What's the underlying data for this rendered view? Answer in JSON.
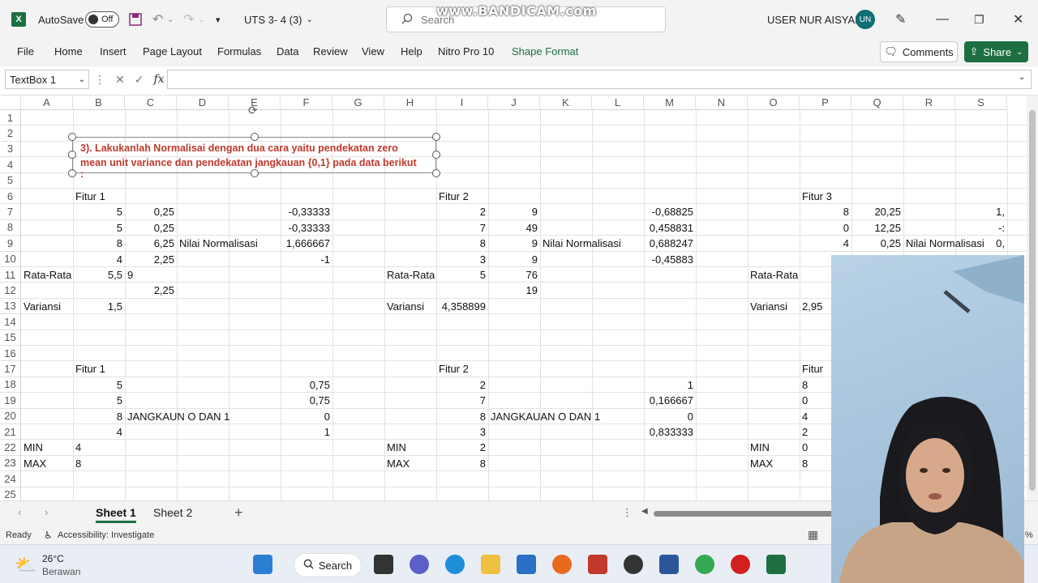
{
  "titlebar": {
    "autosave_label": "AutoSave",
    "autosave_state": "Off",
    "file_name": "UTS 3- 4 (3)",
    "search_placeholder": "Search",
    "watermark": "www.BANDICAM.com",
    "user_name": "USER NUR AISYAH",
    "user_initials": "UN"
  },
  "ribbon": {
    "tabs": [
      "File",
      "Home",
      "Insert",
      "Page Layout",
      "Formulas",
      "Data",
      "Review",
      "View",
      "Help",
      "Nitro Pro 10",
      "Shape Format"
    ],
    "active_tab": "Shape Format",
    "comments_label": "Comments",
    "share_label": "Share"
  },
  "formula_bar": {
    "name_box": "TextBox 1",
    "fx_label": "fx",
    "formula": ""
  },
  "columns": [
    "A",
    "B",
    "C",
    "D",
    "E",
    "F",
    "G",
    "H",
    "I",
    "J",
    "K",
    "L",
    "M",
    "N",
    "O",
    "P",
    "Q",
    "R",
    "S"
  ],
  "rows": [
    "1",
    "2",
    "3",
    "4",
    "5",
    "6",
    "7",
    "8",
    "9",
    "10",
    "11",
    "12",
    "13",
    "14",
    "15",
    "16",
    "17",
    "18",
    "19",
    "20",
    "21",
    "22",
    "23",
    "24",
    "25"
  ],
  "textbox": {
    "line1": "3). Lakukanlah Normalisai dengan dua cara yaitu pendekatan zero",
    "line2": "mean unit variance dan pendekatan jangkauan {0,1} pada data berikut",
    "line3": ":"
  },
  "cells": [
    {
      "ref": "B6",
      "text": "Fitur 1",
      "align": "l"
    },
    {
      "ref": "I6",
      "text": "Fitur 2",
      "align": "l"
    },
    {
      "ref": "P6",
      "text": "Fitur 3",
      "align": "l"
    },
    {
      "ref": "B7",
      "text": "5",
      "align": "r"
    },
    {
      "ref": "C7",
      "text": "0,25",
      "align": "r"
    },
    {
      "ref": "F7",
      "text": "-0,33333",
      "align": "r"
    },
    {
      "ref": "I7",
      "text": "2",
      "align": "r"
    },
    {
      "ref": "J7",
      "text": "9",
      "align": "r"
    },
    {
      "ref": "M7",
      "text": "-0,68825",
      "align": "r"
    },
    {
      "ref": "P7",
      "text": "8",
      "align": "r"
    },
    {
      "ref": "Q7",
      "text": "20,25",
      "align": "r"
    },
    {
      "ref": "S7",
      "text": "1,",
      "align": "r"
    },
    {
      "ref": "B8",
      "text": "5",
      "align": "r"
    },
    {
      "ref": "C8",
      "text": "0,25",
      "align": "r"
    },
    {
      "ref": "F8",
      "text": "-0,33333",
      "align": "r"
    },
    {
      "ref": "I8",
      "text": "7",
      "align": "r"
    },
    {
      "ref": "J8",
      "text": "49",
      "align": "r"
    },
    {
      "ref": "M8",
      "text": "0,458831",
      "align": "r"
    },
    {
      "ref": "P8",
      "text": "0",
      "align": "r"
    },
    {
      "ref": "Q8",
      "text": "12,25",
      "align": "r"
    },
    {
      "ref": "S8",
      "text": "-:",
      "align": "r"
    },
    {
      "ref": "B9",
      "text": "8",
      "align": "r"
    },
    {
      "ref": "C9",
      "text": "6,25",
      "align": "r"
    },
    {
      "ref": "D9",
      "text": "Nilai Normalisasi",
      "align": "l"
    },
    {
      "ref": "F9",
      "text": "1,666667",
      "align": "r"
    },
    {
      "ref": "I9",
      "text": "8",
      "align": "r"
    },
    {
      "ref": "J9",
      "text": "9",
      "align": "r"
    },
    {
      "ref": "K9",
      "text": "Nilai Normalisasi",
      "align": "l"
    },
    {
      "ref": "M9",
      "text": "0,688247",
      "align": "r"
    },
    {
      "ref": "P9",
      "text": "4",
      "align": "r"
    },
    {
      "ref": "Q9",
      "text": "0,25",
      "align": "r"
    },
    {
      "ref": "R9",
      "text": "Nilai Normalisasi",
      "align": "l"
    },
    {
      "ref": "S9",
      "text": "0,",
      "align": "r"
    },
    {
      "ref": "B10",
      "text": "4",
      "align": "r"
    },
    {
      "ref": "C10",
      "text": "2,25",
      "align": "r"
    },
    {
      "ref": "F10",
      "text": "-1",
      "align": "r"
    },
    {
      "ref": "I10",
      "text": "3",
      "align": "r"
    },
    {
      "ref": "J10",
      "text": "9",
      "align": "r"
    },
    {
      "ref": "M10",
      "text": "-0,45883",
      "align": "r"
    },
    {
      "ref": "P10",
      "text": "2",
      "align": "r"
    },
    {
      "ref": "A11",
      "text": "Rata-Rata",
      "align": "l"
    },
    {
      "ref": "B11",
      "text": "5,5",
      "align": "r"
    },
    {
      "ref": "C11",
      "text": "9",
      "align": "l"
    },
    {
      "ref": "H11",
      "text": "Rata-Rata",
      "align": "l"
    },
    {
      "ref": "I11",
      "text": "5",
      "align": "r"
    },
    {
      "ref": "J11",
      "text": "76",
      "align": "r"
    },
    {
      "ref": "O11",
      "text": "Rata-Rata",
      "align": "l"
    },
    {
      "ref": "C12",
      "text": "2,25",
      "align": "r"
    },
    {
      "ref": "J12",
      "text": "19",
      "align": "r"
    },
    {
      "ref": "A13",
      "text": "Variansi",
      "align": "l"
    },
    {
      "ref": "B13",
      "text": "1,5",
      "align": "r"
    },
    {
      "ref": "H13",
      "text": "Variansi",
      "align": "l"
    },
    {
      "ref": "I13",
      "text": "4,358899",
      "align": "r"
    },
    {
      "ref": "O13",
      "text": "Variansi",
      "align": "l"
    },
    {
      "ref": "P13",
      "text": "2,95",
      "align": "l"
    },
    {
      "ref": "B17",
      "text": "Fitur 1",
      "align": "l"
    },
    {
      "ref": "I17",
      "text": "Fitur 2",
      "align": "l"
    },
    {
      "ref": "P17",
      "text": "Fitur",
      "align": "l"
    },
    {
      "ref": "B18",
      "text": "5",
      "align": "r"
    },
    {
      "ref": "F18",
      "text": "0,75",
      "align": "r"
    },
    {
      "ref": "I18",
      "text": "2",
      "align": "r"
    },
    {
      "ref": "M18",
      "text": "1",
      "align": "r"
    },
    {
      "ref": "P18",
      "text": "8",
      "align": "l"
    },
    {
      "ref": "B19",
      "text": "5",
      "align": "r"
    },
    {
      "ref": "F19",
      "text": "0,75",
      "align": "r"
    },
    {
      "ref": "I19",
      "text": "7",
      "align": "r"
    },
    {
      "ref": "M19",
      "text": "0,166667",
      "align": "r"
    },
    {
      "ref": "P19",
      "text": "0",
      "align": "l"
    },
    {
      "ref": "B20",
      "text": "8",
      "align": "r"
    },
    {
      "ref": "C20",
      "text": "JANGKAUN O DAN 1",
      "align": "l"
    },
    {
      "ref": "F20",
      "text": "0",
      "align": "r"
    },
    {
      "ref": "I20",
      "text": "8",
      "align": "r"
    },
    {
      "ref": "J20",
      "text": "JANGKAUAN O DAN 1",
      "align": "l"
    },
    {
      "ref": "M20",
      "text": "0",
      "align": "r"
    },
    {
      "ref": "P20",
      "text": "4",
      "align": "l"
    },
    {
      "ref": "B21",
      "text": "4",
      "align": "r"
    },
    {
      "ref": "F21",
      "text": "1",
      "align": "r"
    },
    {
      "ref": "I21",
      "text": "3",
      "align": "r"
    },
    {
      "ref": "M21",
      "text": "0,833333",
      "align": "r"
    },
    {
      "ref": "P21",
      "text": "2",
      "align": "l"
    },
    {
      "ref": "A22",
      "text": "MIN",
      "align": "l"
    },
    {
      "ref": "B22",
      "text": "4",
      "align": "l"
    },
    {
      "ref": "H22",
      "text": "MIN",
      "align": "l"
    },
    {
      "ref": "I22",
      "text": "2",
      "align": "r"
    },
    {
      "ref": "O22",
      "text": "MIN",
      "align": "l"
    },
    {
      "ref": "P22",
      "text": "0",
      "align": "l"
    },
    {
      "ref": "A23",
      "text": "MAX",
      "align": "l"
    },
    {
      "ref": "B23",
      "text": "8",
      "align": "l"
    },
    {
      "ref": "H23",
      "text": "MAX",
      "align": "l"
    },
    {
      "ref": "I23",
      "text": "8",
      "align": "r"
    },
    {
      "ref": "O23",
      "text": "MAX",
      "align": "l"
    },
    {
      "ref": "P23",
      "text": "8",
      "align": "l"
    }
  ],
  "sheets": {
    "tabs": [
      "Sheet 1",
      "Sheet 2"
    ],
    "active": "Sheet 1"
  },
  "statusbar": {
    "ready": "Ready",
    "accessibility": "Accessibility: Investigate",
    "zoom_partial": "%"
  },
  "taskbar": {
    "temperature": "26°C",
    "weather": "Berawan",
    "search_label": "Search"
  },
  "colors": {
    "excel_green": "#1d6f42",
    "textbox_red": "#c0392b"
  }
}
